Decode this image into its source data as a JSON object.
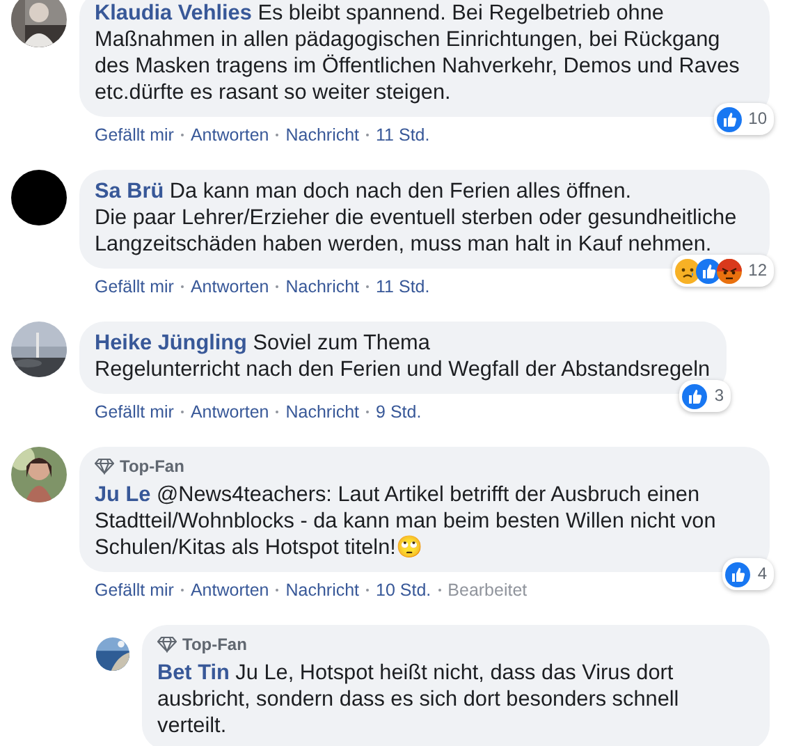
{
  "comments": [
    {
      "avatar": {
        "kind": "picture"
      },
      "author": "Klaudia Vehlies",
      "text": "Es bleibt spannend. Bei Regelbetrieb ohne Maßnahmen in allen pädagogischen Einrichtungen, bei Rückgang des Masken tragens im Öffentlichen Nahverkehr, Demos und Raves etc.dürfte es rasant so weiter steigen.",
      "reactions": {
        "icons": [
          {
            "kind": "like"
          }
        ],
        "count": "10"
      },
      "actions": [
        "Gefällt mir",
        "Antworten",
        "Nachricht"
      ],
      "time": "11 Std."
    },
    {
      "avatar": {
        "kind": "blank"
      },
      "author": "Sa Brü",
      "text": "Da kann man doch nach den Ferien alles öffnen.\nDie paar Lehrer/Erzieher die eventuell sterben oder gesundheitliche Langzeitschäden haben werden, muss man halt in Kauf nehmen.",
      "reactions": {
        "icons": [
          {
            "kind": "sad"
          },
          {
            "kind": "like"
          },
          {
            "kind": "angry"
          }
        ],
        "count": "12"
      },
      "actions": [
        "Gefällt mir",
        "Antworten",
        "Nachricht"
      ],
      "time": "11 Std."
    },
    {
      "avatar": {
        "kind": "picture"
      },
      "author": "Heike Jüngling",
      "text": "Soviel zum Thema\nRegelunterricht nach den Ferien und Wegfall der Abstandsregeln",
      "reactions": {
        "icons": [
          {
            "kind": "like"
          }
        ],
        "count": "3"
      },
      "actions": [
        "Gefällt mir",
        "Antworten",
        "Nachricht"
      ],
      "time": "9 Std."
    },
    {
      "avatar": {
        "kind": "picture"
      },
      "badge": "Top-Fan",
      "author": "Ju Le",
      "text": "@News4teachers: Laut Artikel betrifft der Ausbruch einen Stadtteil/Wohnblocks - da kann man beim besten Willen nicht von Schulen/Kitas als Hotspot titeln!🙄",
      "reactions": {
        "icons": [
          {
            "kind": "like"
          }
        ],
        "count": "4"
      },
      "actions": [
        "Gefällt mir",
        "Antworten",
        "Nachricht"
      ],
      "time": "10 Std.",
      "edited": "Bearbeitet",
      "replies": [
        {
          "avatar": {
            "kind": "picture"
          },
          "badge": "Top-Fan",
          "author": "Bet Tin",
          "text": "Ju Le, Hotspot heißt nicht, dass das Virus dort ausbricht, sondern dass es sich dort besonders schnell verteilt."
        }
      ]
    }
  ]
}
